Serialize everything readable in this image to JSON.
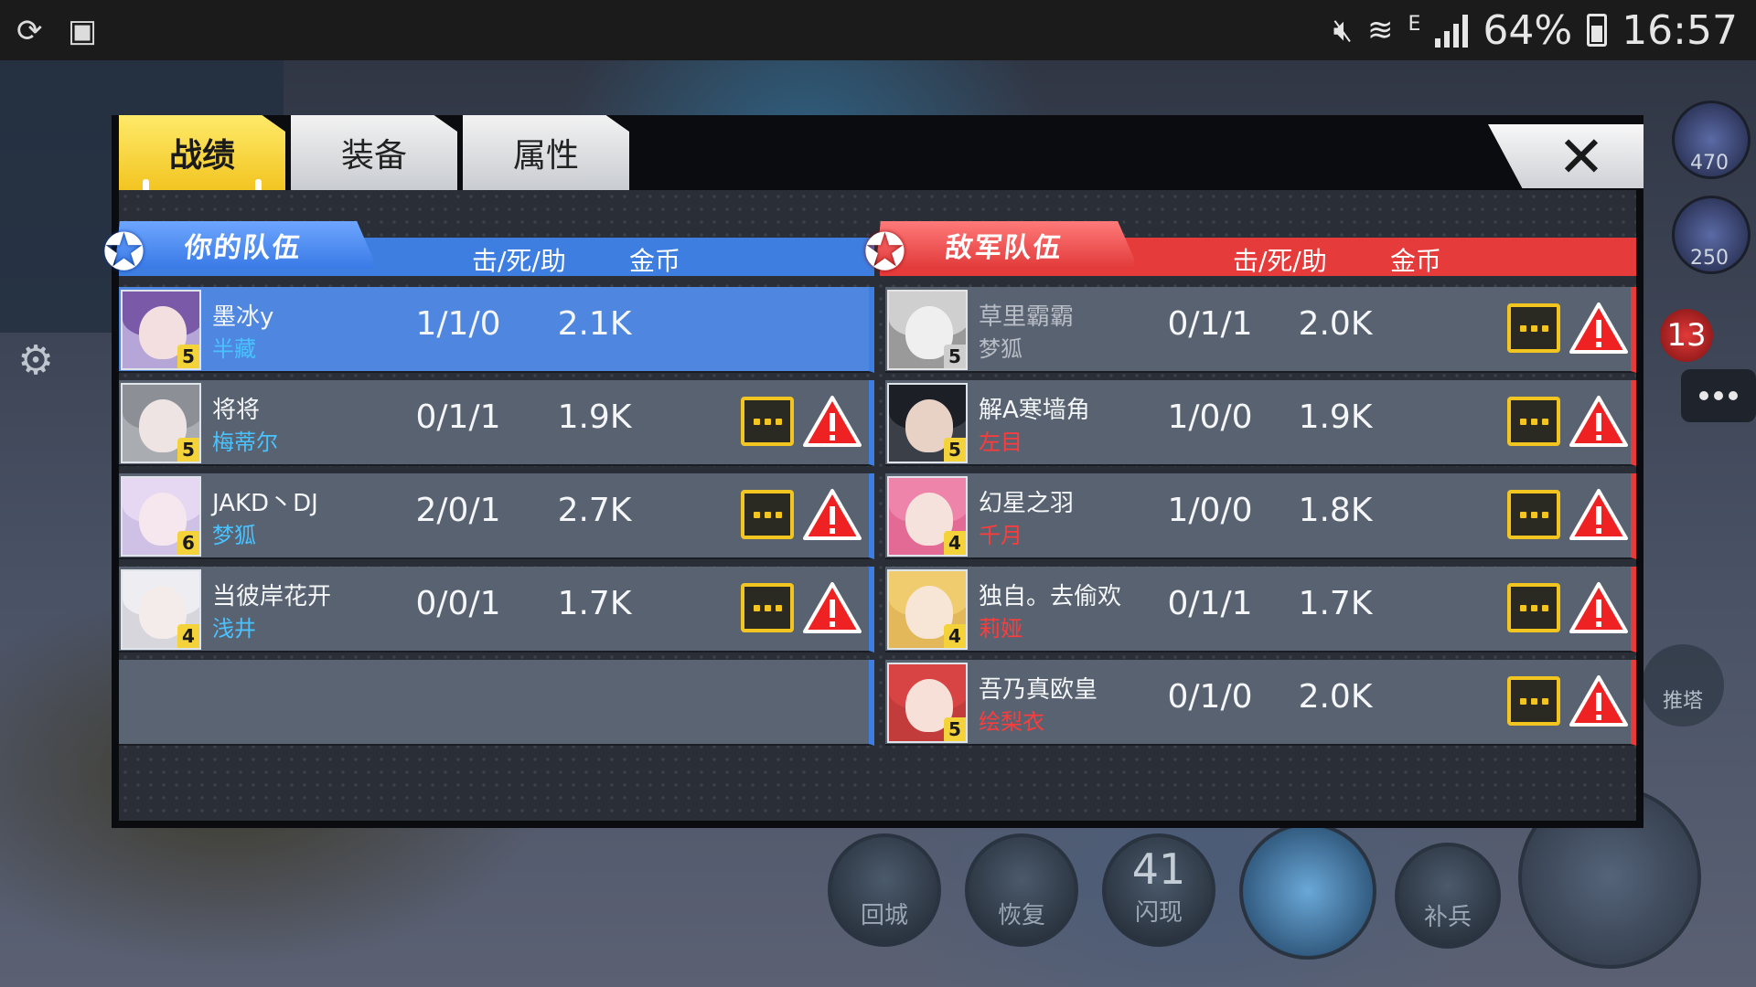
{
  "status_bar": {
    "battery": "64%",
    "time": "16:57",
    "network": "E"
  },
  "hud": {
    "hero1_value": "470",
    "hero2_value": "250",
    "kill_count": "13",
    "push_tower_label": "推塔",
    "skills": [
      {
        "label": "回城"
      },
      {
        "label": "恢复"
      },
      {
        "label": "闪现",
        "cooldown": "41"
      },
      {
        "label": ""
      },
      {
        "label": "补兵"
      }
    ]
  },
  "tabs": [
    {
      "label": "战绩",
      "active": true
    },
    {
      "label": "装备",
      "active": false
    },
    {
      "label": "属性",
      "active": false
    }
  ],
  "close_label": "✕",
  "my_team": {
    "title": "你的队伍",
    "kda_header": "击/死/助",
    "gold_header": "金币",
    "accent_color": "#3d7ee0",
    "players": [
      {
        "name": "墨冰y",
        "hero": "半藏",
        "level": "5",
        "kda": "1/1/0",
        "gold": "2.1K",
        "is_self": true
      },
      {
        "name": "将将",
        "hero": "梅蒂尔",
        "level": "5",
        "kda": "0/1/1",
        "gold": "1.9K"
      },
      {
        "name": "JAKD丶DJ",
        "hero": "梦狐",
        "level": "6",
        "kda": "2/0/1",
        "gold": "2.7K"
      },
      {
        "name": "当彼岸花开",
        "hero": "浅井",
        "level": "4",
        "kda": "0/0/1",
        "gold": "1.7K"
      }
    ]
  },
  "enemy_team": {
    "title": "敌军队伍",
    "kda_header": "击/死/助",
    "gold_header": "金币",
    "accent_color": "#e63b3b",
    "players": [
      {
        "name": "草里霸霸",
        "hero": "梦狐",
        "level": "5",
        "kda": "0/1/1",
        "gold": "2.0K",
        "dead": true
      },
      {
        "name": "解A寒墙角",
        "hero": "左目",
        "level": "5",
        "kda": "1/0/0",
        "gold": "1.9K"
      },
      {
        "name": "幻星之羽",
        "hero": "千月",
        "level": "4",
        "kda": "1/0/0",
        "gold": "1.8K"
      },
      {
        "name": "独自。去偷欢",
        "hero": "莉娅",
        "level": "4",
        "kda": "0/1/1",
        "gold": "1.7K"
      },
      {
        "name": "吾乃真欧皇",
        "hero": "绘梨衣",
        "level": "5",
        "kda": "0/1/0",
        "gold": "2.0K"
      }
    ]
  }
}
